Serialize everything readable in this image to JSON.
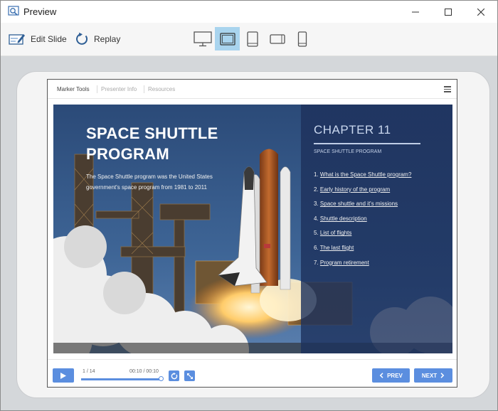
{
  "window": {
    "title": "Preview"
  },
  "toolbar": {
    "edit_label": "Edit Slide",
    "replay_label": "Replay"
  },
  "player": {
    "tabs": [
      "Marker Tools",
      "Presenter Info",
      "Resources"
    ],
    "slide": {
      "title_line1": "SPACE SHUTTLE",
      "title_line2": "PROGRAM",
      "description": "The Space Shuttle program was the United States government's space program from 1981 to 2011",
      "chapter": "CHAPTER 11",
      "chapter_subtitle": "SPACE SHUTTLE PROGRAM",
      "toc": [
        {
          "num": "1.",
          "label": "What is the Space Shuttle program?"
        },
        {
          "num": "2.",
          "label": "Early history of the program"
        },
        {
          "num": "3.",
          "label": "Space shuttle and it's missions"
        },
        {
          "num": "4.",
          "label": "Shuttle description"
        },
        {
          "num": "5.",
          "label": "List of flights"
        },
        {
          "num": "6.",
          "label": "The last flight"
        },
        {
          "num": "7.",
          "label": "Program retirement"
        }
      ]
    },
    "controls": {
      "slide_count": "1 / 14",
      "time": "00:10 / 00:10",
      "progress": 1.0,
      "prev_label": "PREV",
      "next_label": "NEXT"
    }
  },
  "colors": {
    "accent": "#5b8edf",
    "active_device": "#a9d4ee",
    "panel": "#1f335e"
  }
}
